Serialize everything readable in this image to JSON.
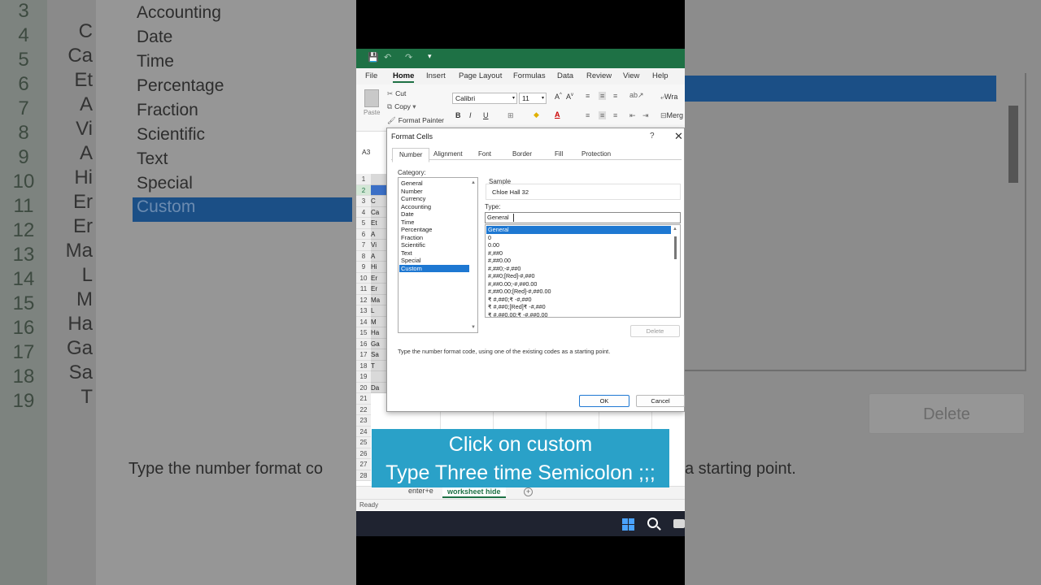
{
  "background": {
    "row_numbers": [
      "3",
      "4",
      "5",
      "6",
      "7",
      "8",
      "9",
      "10",
      "11",
      "12",
      "13",
      "14",
      "15",
      "16",
      "17",
      "18",
      "19"
    ],
    "col_b_cells": [
      "C",
      "Ca",
      "Et",
      "A",
      "Vi",
      "A",
      "Hi",
      "Er",
      "Er",
      "Ma",
      "L",
      "M",
      "Ha",
      "Ga",
      "Sa",
      "T",
      ""
    ],
    "categories": [
      "Accounting",
      "Date",
      "Time",
      "Percentage",
      "Fraction",
      "Scientific",
      "Text",
      "Special",
      "Custom"
    ],
    "delete_label": "Delete",
    "hint_left": "Type the number format co",
    "hint_right": "a starting point."
  },
  "excel": {
    "ribbon_tabs": [
      "File",
      "Home",
      "Insert",
      "Page Layout",
      "Formulas",
      "Data",
      "Review",
      "View",
      "Help"
    ],
    "active_tab": "Home",
    "clipboard": {
      "paste": "Paste",
      "cut": "Cut",
      "copy": "Copy",
      "format_painter": "Format Painter"
    },
    "font_name": "Calibri",
    "font_size": "11",
    "wrap_label": "Wra",
    "merge_label": "Merg",
    "name_box": "A3",
    "row_numbers": [
      "1",
      "2",
      "3",
      "4",
      "5",
      "6",
      "7",
      "8",
      "9",
      "10",
      "11",
      "12",
      "13",
      "14",
      "15",
      "16",
      "17",
      "18",
      "19",
      "20",
      "21",
      "22",
      "23",
      "24",
      "25",
      "26",
      "27",
      "28"
    ],
    "col_a_cells": [
      "",
      "",
      "C",
      "Ca",
      "Et",
      "A",
      "Vi",
      "A",
      "Hi",
      "Er",
      "Er",
      "Ma",
      "L",
      "M",
      "Ha",
      "Ga",
      "Sa",
      "T",
      "",
      "Da"
    ],
    "sheet_tabs": [
      "enter+e",
      "worksheet hide"
    ],
    "active_sheet": "worksheet hide",
    "status": "Ready"
  },
  "dialog": {
    "title": "Format Cells",
    "help": "?",
    "close": "✕",
    "tabs": [
      "Number",
      "Alignment",
      "Font",
      "Border",
      "Fill",
      "Protection"
    ],
    "active_tab": "Number",
    "category_label": "Category:",
    "categories": [
      "General",
      "Number",
      "Currency",
      "Accounting",
      "Date",
      "Time",
      "Percentage",
      "Fraction",
      "Scientific",
      "Text",
      "Special",
      "Custom"
    ],
    "selected_category": "Custom",
    "sample_label": "Sample",
    "sample_value": "Chloe Hall 32",
    "type_label": "Type:",
    "type_value": "General",
    "formats": [
      "General",
      "0",
      "0.00",
      "#,##0",
      "#,##0.00",
      "#,##0;-#,##0",
      "#,##0;[Red]-#,##0",
      "#,##0.00;-#,##0.00",
      "#,##0.00;[Red]-#,##0.00",
      "₹ #,##0;₹ -#,##0",
      "₹ #,##0;[Red]₹ -#,##0",
      "₹ #,##0.00;₹ -#,##0.00"
    ],
    "selected_format": "General",
    "delete_label": "Delete",
    "hint": "Type the number format code, using one of the existing codes as a starting point.",
    "ok_label": "OK",
    "cancel_label": "Cancel"
  },
  "caption": {
    "line1": "Click on custom",
    "line2": "Type Three time Semicolon ;;;"
  },
  "colors": {
    "excel_green": "#1e7145",
    "selection_blue": "#1e78d2",
    "caption_bg": "#2aa1c8",
    "taskbar": "#1f2330"
  }
}
